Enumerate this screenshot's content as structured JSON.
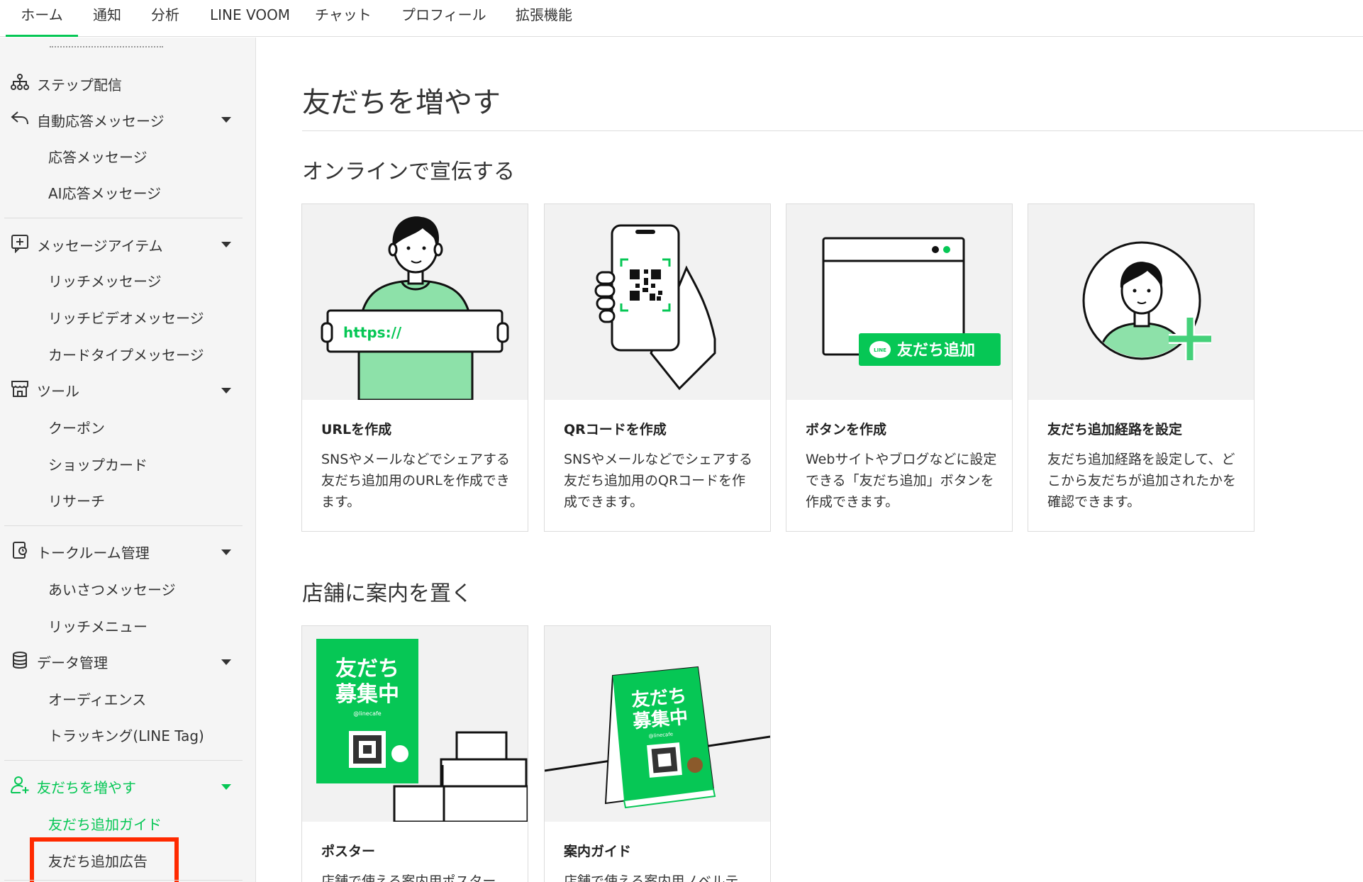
{
  "topnav": {
    "tabs": [
      "ホーム",
      "通知",
      "分析",
      "LINE VOOM",
      "チャット",
      "プロフィール",
      "拡張機能"
    ],
    "active_color": "#06c755"
  },
  "sidebar": {
    "step_delivery": "ステップ配信",
    "auto_reply": {
      "label": "自動応答メッセージ",
      "children": [
        "応答メッセージ",
        "AI応答メッセージ"
      ]
    },
    "message_items": {
      "label": "メッセージアイテム",
      "children": [
        "リッチメッセージ",
        "リッチビデオメッセージ",
        "カードタイプメッセージ"
      ]
    },
    "tools": {
      "label": "ツール",
      "children": [
        "クーポン",
        "ショップカード",
        "リサーチ"
      ]
    },
    "talkroom": {
      "label": "トークルーム管理",
      "children": [
        "あいさつメッセージ",
        "リッチメニュー"
      ]
    },
    "data_mgmt": {
      "label": "データ管理",
      "children": [
        "オーディエンス",
        "トラッキング(LINE Tag)"
      ]
    },
    "add_friends": {
      "label": "友だちを増やす",
      "children": [
        "友だち追加ガイド",
        "友だち追加広告"
      ]
    },
    "highlight_color": "#ff2a00"
  },
  "main": {
    "title": "友だちを増やす",
    "online_section": {
      "title": "オンラインで宣伝する",
      "cards": [
        {
          "title": "URLを作成",
          "desc": "SNSやメールなどでシェアする友だち追加用のURLを作成できます。",
          "banner_text": "https://"
        },
        {
          "title": "QRコードを作成",
          "desc": "SNSやメールなどでシェアする友だち追加用のQRコードを作成できます。"
        },
        {
          "title": "ボタンを作成",
          "desc": "Webサイトやブログなどに設定できる「友だち追加」ボタンを作成できます。",
          "button_text": "友だち追加",
          "button_logo": "LINE"
        },
        {
          "title": "友だち追加経路を設定",
          "desc": "友だち追加経路を設定して、どこから友だちが追加されたかを確認できます。"
        }
      ]
    },
    "store_section": {
      "title": "店舗に案内を置く",
      "cards": [
        {
          "title": "ポスター",
          "desc": "店舗で使える案内用ポスター",
          "poster_line1": "友だち",
          "poster_line2": "募集中",
          "poster_handle": "@linecafe"
        },
        {
          "title": "案内ガイド",
          "desc": "店舗で使える案内用ノベルテ",
          "poster_line1": "友だち",
          "poster_line2": "募集中",
          "poster_handle": "@linecafe"
        }
      ]
    },
    "brand_color": "#06c755"
  }
}
